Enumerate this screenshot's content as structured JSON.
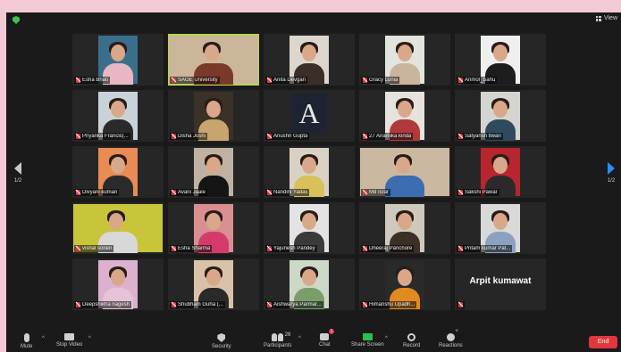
{
  "header": {
    "view_label": "View",
    "shield_icon": "security-shield-icon"
  },
  "colors": {
    "active_border": "#b8d44a",
    "muted_mic": "#e0383e",
    "next_page_arrow": "#2d8cff",
    "share_green": "#27c24c",
    "end_red": "#e0383e"
  },
  "gallery": {
    "page_left": "1/2",
    "page_right": "1/2",
    "tiles": [
      {
        "name": "Esha Bhati",
        "bg": "#3a6f8c",
        "shirt": "#e9b6c4"
      },
      {
        "name": "SAGE University",
        "bg": "#cbb69a",
        "shirt": "#7a3a2a",
        "active": true,
        "wide": true
      },
      {
        "name": "Anita Devgan",
        "bg": "#dcd6cf",
        "shirt": "#3b2e28"
      },
      {
        "name": "Gracy Lunia",
        "bg": "#e2e4de",
        "shirt": "#c9b59c"
      },
      {
        "name": "Anmol_Sahu",
        "bg": "#efefef",
        "shirt": "#1d1d1d"
      },
      {
        "name": "Priyanka Francis(...",
        "bg": "#c9d2d8",
        "shirt": "#2a2a2a"
      },
      {
        "name": "Disha Joshi",
        "bg": "#3b3128",
        "shirt": "#c8a46e"
      },
      {
        "name": "Anushri Gupta",
        "letter": "A"
      },
      {
        "name": "27 Anamika kinda",
        "bg": "#e6e2dd",
        "shirt": "#b03a3a"
      },
      {
        "name": "Satyansh tiwari",
        "bg": "#d4d4d0",
        "shirt": "#2e4b5e"
      },
      {
        "name": "Divyani kumari",
        "bg": "#e98b53",
        "shirt": "#2b2b2b"
      },
      {
        "name": "Avani Jaale",
        "bg": "#bfb2a2",
        "shirt": "#151515"
      },
      {
        "name": "Nandini Yadav",
        "bg": "#d9d2c4",
        "shirt": "#d8c05b"
      },
      {
        "name": "Md Israr",
        "bg": "#cbb8a0",
        "shirt": "#3c6db0",
        "wide": true
      },
      {
        "name": "Sakshi Pawar",
        "bg": "#b8252f",
        "shirt": "#2a2a2a"
      },
      {
        "name": "vishal soneri",
        "bg": "#c8c53a",
        "shirt": "#d8d8d8",
        "wide": true
      },
      {
        "name": "Esha Sharma",
        "bg": "#d98f8f",
        "shirt": "#d43b6a"
      },
      {
        "name": "Yajunesh Pandey",
        "bg": "#e3e3e3",
        "shirt": "#3a3a3a"
      },
      {
        "name": "Dheeraj Panchore",
        "bg": "#cfc8bd",
        "shirt": "#3b2f26"
      },
      {
        "name": "Pritam kumar Pat...",
        "bg": "#d9d9d9",
        "shirt": "#8aa2c0"
      },
      {
        "name": "Deepshikha nagesh",
        "bg": "#dcb0cf",
        "shirt": "#e6c3d7"
      },
      {
        "name": "Shubham Guha (...",
        "bg": "#d9c2a8",
        "shirt": "#2a2a2a"
      },
      {
        "name": "Aishwarya Parmar...",
        "bg": "#cdd8c8",
        "shirt": "#7a9e6a"
      },
      {
        "name": "Himanshu Upadh...",
        "bg": "#2a2a2a",
        "shirt": "#e08a22"
      },
      {
        "name": "",
        "display_name": "Arpit kumawat"
      }
    ]
  },
  "toolbar": {
    "mute": "Mute",
    "stop_video": "Stop Video",
    "security": "Security",
    "participants": "Participants",
    "participants_count": "26",
    "chat": "Chat",
    "chat_badge": "1",
    "share_screen": "Share Screen",
    "record": "Record",
    "reactions": "Reactions",
    "end": "End"
  }
}
